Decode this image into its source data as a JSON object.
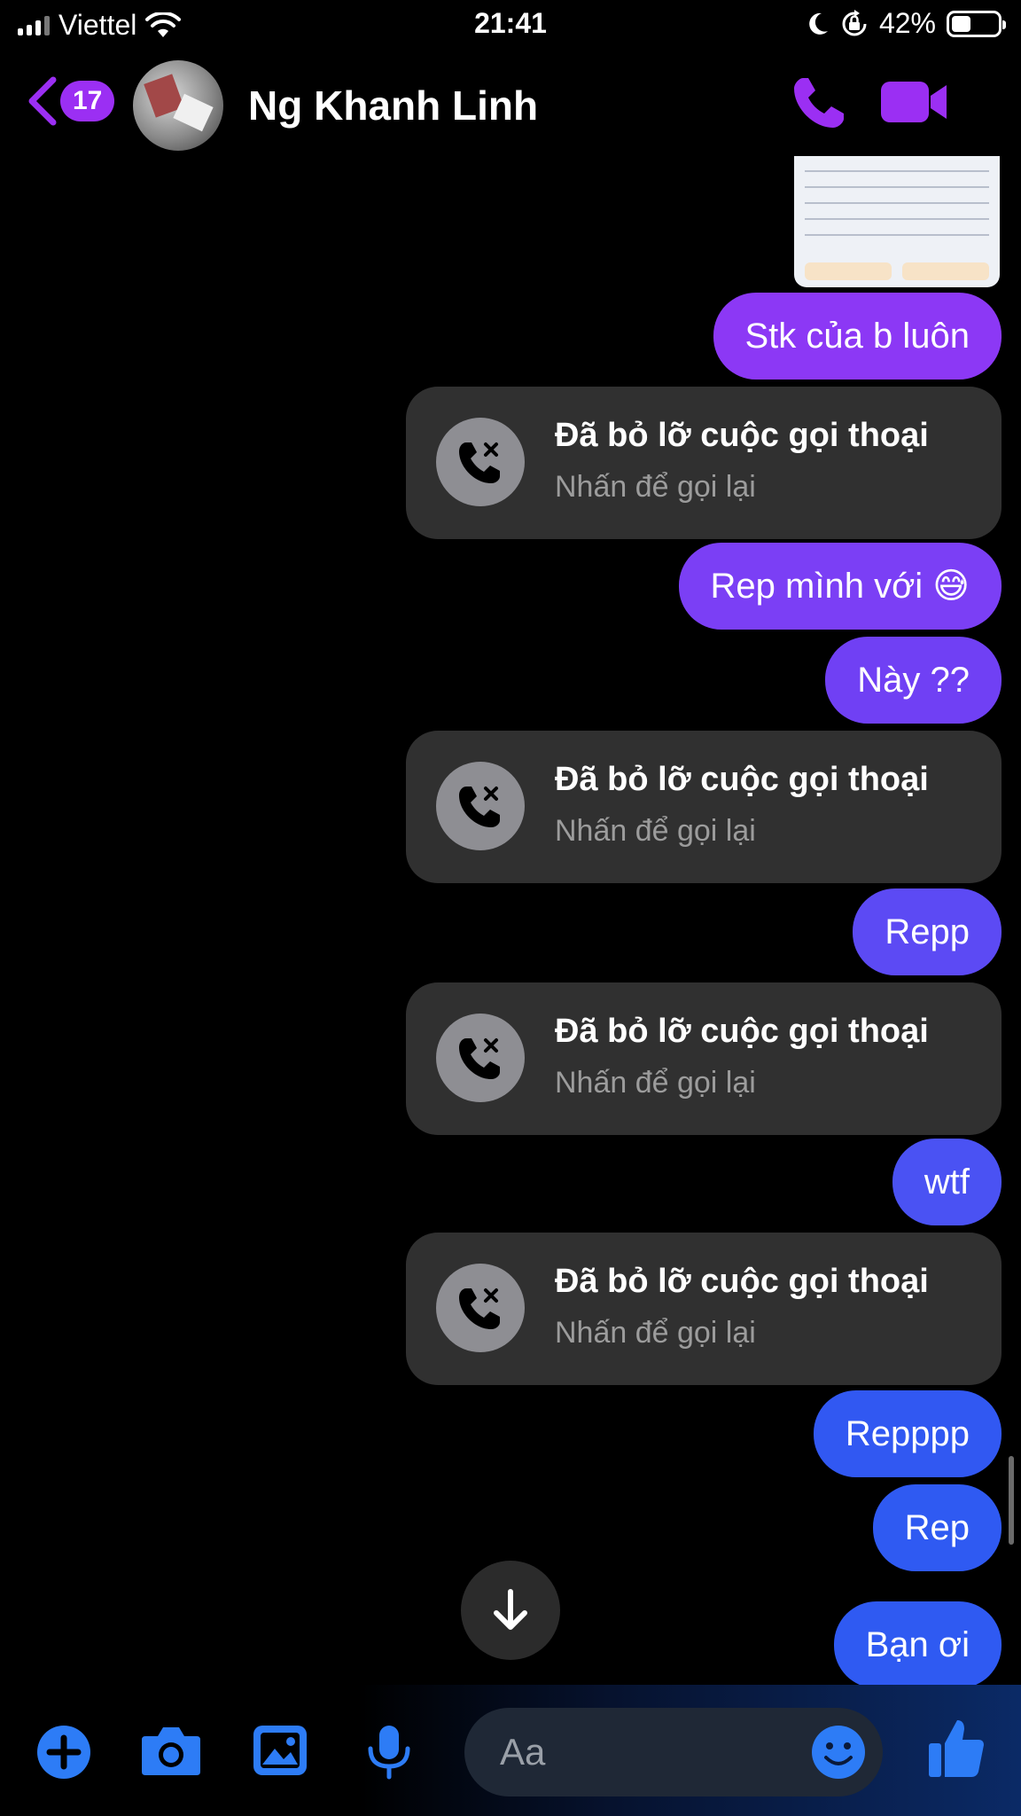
{
  "status_bar": {
    "carrier": "Viettel",
    "time": "21:41",
    "battery": "42%",
    "battery_level": 0.42
  },
  "header": {
    "back_count": "17",
    "contact_name": "Ng Khanh Linh"
  },
  "messages": [
    {
      "type": "sent",
      "text": "Stk của b luôn"
    },
    {
      "type": "missed-call",
      "title": "Đã bỏ lỡ cuộc gọi thoại",
      "subtitle": "Nhấn để gọi lại"
    },
    {
      "type": "sent",
      "text": "Rep mình với 😅"
    },
    {
      "type": "sent",
      "text": "Này ??"
    },
    {
      "type": "missed-call",
      "title": "Đã bỏ lỡ cuộc gọi thoại",
      "subtitle": "Nhấn để gọi lại"
    },
    {
      "type": "sent",
      "text": "Repp"
    },
    {
      "type": "missed-call",
      "title": "Đã bỏ lỡ cuộc gọi thoại",
      "subtitle": "Nhấn để gọi lại"
    },
    {
      "type": "sent",
      "text": "wtf"
    },
    {
      "type": "missed-call",
      "title": "Đã bỏ lỡ cuộc gọi thoại",
      "subtitle": "Nhấn để gọi lại"
    },
    {
      "type": "sent",
      "text": "Repppp"
    },
    {
      "type": "sent",
      "text": "Rep"
    },
    {
      "type": "sent",
      "text": "Bạn ơi"
    }
  ],
  "composer": {
    "placeholder": "Aa"
  },
  "colors": {
    "accent": "#9b2ff3",
    "bubble_purple": "#8c38f5",
    "bubble_violet": "#6a44f4",
    "bubble_blue": "#2f5af2",
    "missed_bg": "#303030",
    "toolbar_blue": "#2d7cf6"
  },
  "icons": {
    "back": "chevron-left-icon",
    "call": "phone-icon",
    "video": "video-camera-icon",
    "missed_call": "missed-call-icon",
    "scroll_down": "arrow-down-icon",
    "plus": "plus-icon",
    "camera": "camera-icon",
    "gallery": "image-icon",
    "mic": "microphone-icon",
    "emoji": "emoji-icon",
    "like": "thumbs-up-icon"
  }
}
